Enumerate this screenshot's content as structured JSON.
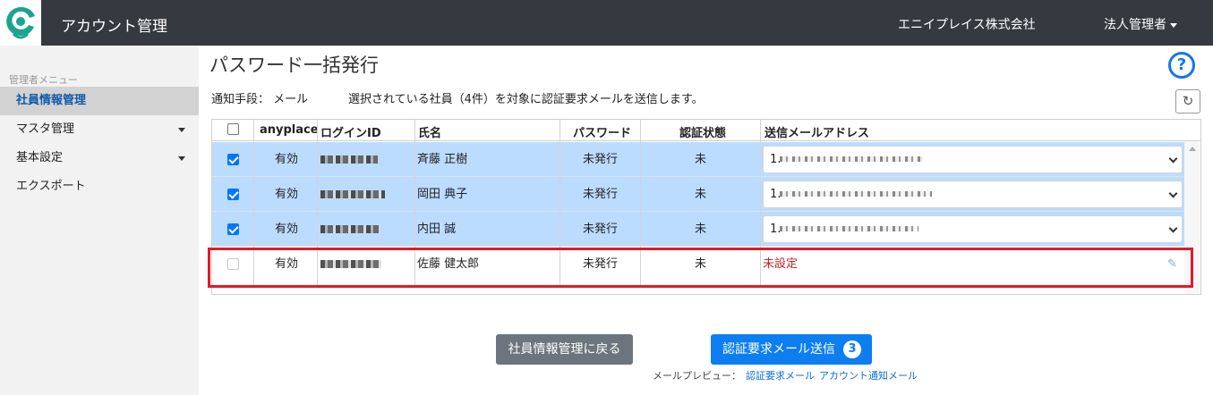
{
  "header": {
    "app_title": "アカウント管理",
    "company": "エニイプレイス株式会社",
    "user_menu": "法人管理者"
  },
  "sidebar": {
    "heading": "管理者メニュー",
    "items": [
      {
        "label": "社員情報管理",
        "active": true
      },
      {
        "label": "マスタ管理",
        "has_submenu": true
      },
      {
        "label": "基本設定",
        "has_submenu": true
      },
      {
        "label": "エクスポート"
      }
    ]
  },
  "main": {
    "title": "パスワード一括発行",
    "notify_method": "通知手段： メール",
    "notify_message": "選択されている社員（4件）を対象に認証要求メールを送信します。"
  },
  "table": {
    "headers": [
      "anyplace",
      "ログインID",
      "氏名",
      "パスワード",
      "認証状態",
      "送信メールアドレス"
    ],
    "rows": [
      {
        "checked": true,
        "anyplace": "有効",
        "name": "斉藤 正樹",
        "password": "未発行",
        "auth": "未",
        "email_prefix": "1."
      },
      {
        "checked": true,
        "anyplace": "有効",
        "name": "岡田 典子",
        "password": "未発行",
        "auth": "未",
        "email_prefix": "1."
      },
      {
        "checked": true,
        "anyplace": "有効",
        "name": "内田 誠",
        "password": "未発行",
        "auth": "未",
        "email_prefix": "1."
      },
      {
        "checked": false,
        "disabled": true,
        "anyplace": "有効",
        "name": "佐藤 健太郎",
        "password": "未発行",
        "auth": "未",
        "email_status": "未設定"
      }
    ]
  },
  "footer": {
    "back_button": "社員情報管理に戻る",
    "send_button": "認証要求メール送信",
    "send_count": "3",
    "preview_label": "メールプレビュー：",
    "preview_links": [
      "認証要求メール",
      "アカウント通知メール"
    ]
  },
  "colors": {
    "header_bg": "#343a40",
    "selected_row": "#bcdcff",
    "primary": "#0d7ef0",
    "danger": "#c0262b",
    "highlight": "#e01a28"
  }
}
